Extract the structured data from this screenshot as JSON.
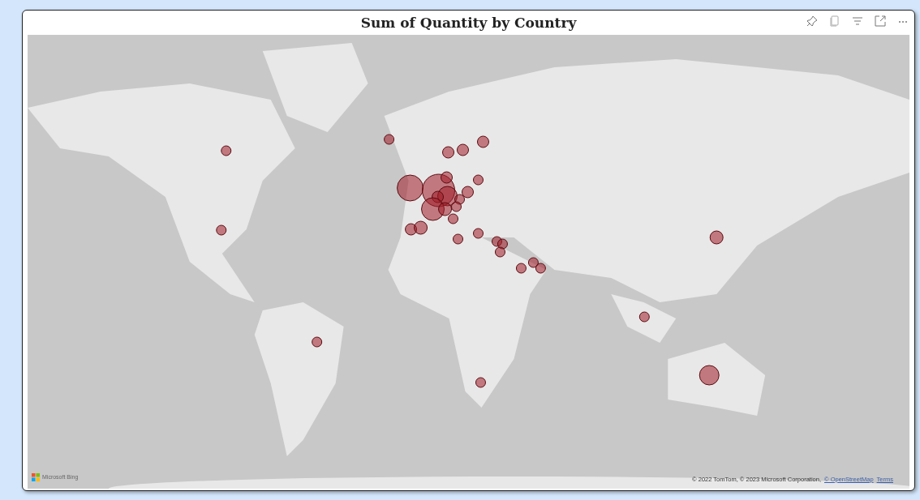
{
  "visual": {
    "title": "Sum of Quantity by Country"
  },
  "map": {
    "kind": "picture",
    "logo_text": "Microsoft Bing",
    "attribution": "© 2022 TomTom, © 2023 Microsoft Corporation,",
    "attribution_links": [
      "© OpenStreetMap",
      "Terms"
    ]
  }
}
